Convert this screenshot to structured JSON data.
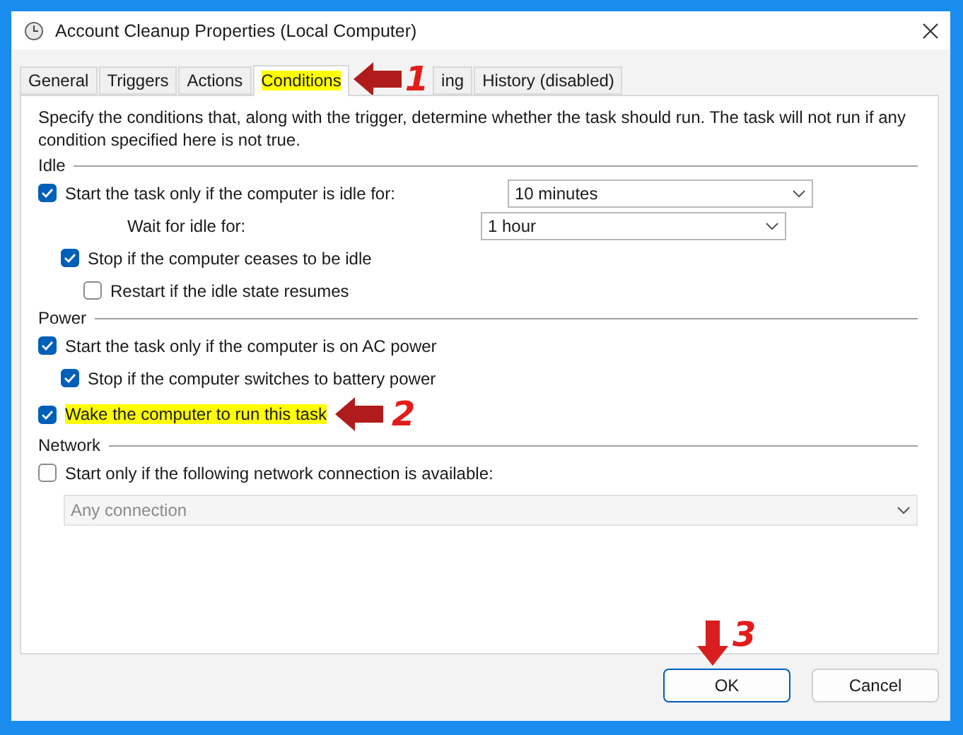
{
  "window": {
    "title": "Account Cleanup Properties (Local Computer)"
  },
  "tabs": [
    {
      "label": "General",
      "selected": false,
      "highlighted": false
    },
    {
      "label": "Triggers",
      "selected": false,
      "highlighted": false
    },
    {
      "label": "Actions",
      "selected": false,
      "highlighted": false
    },
    {
      "label": "Conditions",
      "selected": true,
      "highlighted": true,
      "callout": "1"
    },
    {
      "label": "ing",
      "selected": false,
      "highlighted": false
    },
    {
      "label": "History (disabled)",
      "selected": false,
      "highlighted": false
    }
  ],
  "description": "Specify the conditions that, along with the trigger, determine whether the task should run.  The task will not run  if any condition specified here is not true.",
  "sections": [
    {
      "title": "Idle",
      "rows": [
        {
          "kind": "checkbox",
          "label": "Start the task only if the computer is idle for:",
          "checked": true,
          "value": "10 minutes",
          "children": [
            {
              "kind": "label",
              "label": "Wait for idle for:",
              "value": "1 hour"
            },
            {
              "kind": "checkbox",
              "label": "Stop if the computer ceases to be idle",
              "checked": true,
              "children": [
                {
                  "kind": "checkbox",
                  "label": "Restart if the idle state resumes",
                  "checked": false
                }
              ]
            }
          ]
        }
      ]
    },
    {
      "title": "Power",
      "rows": [
        {
          "kind": "checkbox",
          "label": "Start the task only if the computer is on AC power",
          "checked": true,
          "children": [
            {
              "kind": "checkbox",
              "label": "Stop if the computer switches to battery power",
              "checked": true
            }
          ]
        },
        {
          "kind": "checkbox",
          "label": "Wake the computer to run this task",
          "checked": true,
          "highlighted": true,
          "callout": "2"
        }
      ]
    },
    {
      "title": "Network",
      "rows": [
        {
          "kind": "checkbox",
          "label": "Start only if the following network connection is available:",
          "checked": false
        }
      ],
      "connection": {
        "value": "Any connection",
        "disabled": true
      }
    }
  ],
  "buttons": [
    {
      "label": "OK",
      "default": true,
      "callout": "3"
    },
    {
      "label": "Cancel",
      "default": false
    }
  ]
}
